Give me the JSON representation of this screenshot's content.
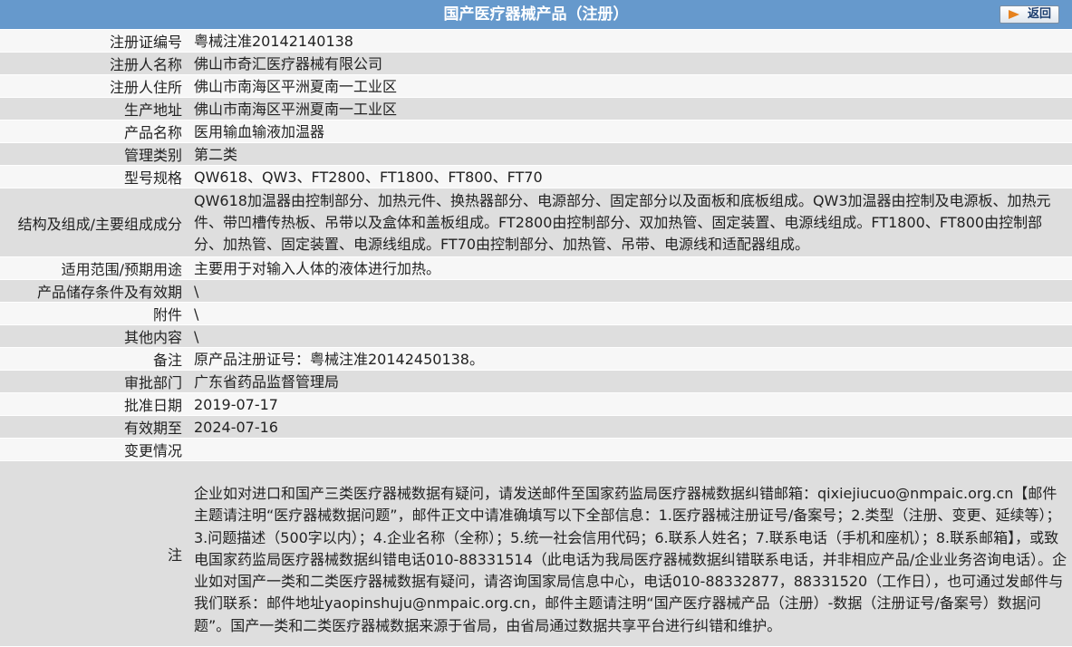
{
  "header": {
    "title": "国产医疗器械产品（注册）",
    "back_label": "返回"
  },
  "rows": [
    {
      "label": "注册证编号",
      "value": "粤械注准20142140138"
    },
    {
      "label": "注册人名称",
      "value": "佛山市奇汇医疗器械有限公司"
    },
    {
      "label": "注册人住所",
      "value": "佛山市南海区平洲夏南一工业区"
    },
    {
      "label": "生产地址",
      "value": "佛山市南海区平洲夏南一工业区"
    },
    {
      "label": "产品名称",
      "value": "医用输血输液加温器"
    },
    {
      "label": "管理类别",
      "value": "第二类"
    },
    {
      "label": "型号规格",
      "value": "QW618、QW3、FT2800、FT1800、FT800、FT70"
    },
    {
      "label": "结构及组成/主要组成成分",
      "value": "QW618加温器由控制部分、加热元件、换热器部分、电源部分、固定部分以及面板和底板组成。QW3加温器由控制及电源板、加热元件、带凹槽传热板、吊带以及盒体和盖板组成。FT2800由控制部分、双加热管、固定装置、电源线组成。FT1800、FT800由控制部分、加热管、固定装置、电源线组成。FT70由控制部分、加热管、吊带、电源线和适配器组成。"
    },
    {
      "label": "适用范围/预期用途",
      "value": "主要用于对输入人体的液体进行加热。"
    },
    {
      "label": "产品储存条件及有效期",
      "value": "\\"
    },
    {
      "label": "附件",
      "value": "\\"
    },
    {
      "label": "其他内容",
      "value": "\\"
    },
    {
      "label": "备注",
      "value": "原产品注册证号：粤械注准20142450138。"
    },
    {
      "label": "审批部门",
      "value": "广东省药品监督管理局"
    },
    {
      "label": "批准日期",
      "value": "2019-07-17"
    },
    {
      "label": "有效期至",
      "value": "2024-07-16"
    },
    {
      "label": "变更情况",
      "value": ""
    },
    {
      "label": "注",
      "value": "企业如对进口和国产三类医疗器械数据有疑问，请发送邮件至国家药监局医疗器械数据纠错邮箱：qixiejiucuo@nmpaic.org.cn【邮件主题请注明“医疗器械数据问题”，邮件正文中请准确填写以下全部信息：1.医疗器械注册证号/备案号；2.类型（注册、变更、延续等）；3.问题描述（500字以内）；4.企业名称（全称）；5.统一社会信用代码；6.联系人姓名；7.联系电话（手机和座机）；8.联系邮箱】，或致电国家药监局医疗器械数据纠错电话010-88331514（此电话为我局医疗器械数据纠错联系电话，并非相应产品/企业业务咨询电话）。企业如对国产一类和二类医疗器械数据有疑问，请咨询国家局信息中心，电话010-88332877，88331520（工作日），也可通过发邮件与我们联系：邮件地址yaopinshuju@nmpaic.org.cn，邮件主题请注明“国产医疗器械产品（注册）-数据（注册证号/备案号）数据问题”。国产一类和二类医疗器械数据来源于省局，由省局通过数据共享平台进行纠错和维护。"
    }
  ]
}
